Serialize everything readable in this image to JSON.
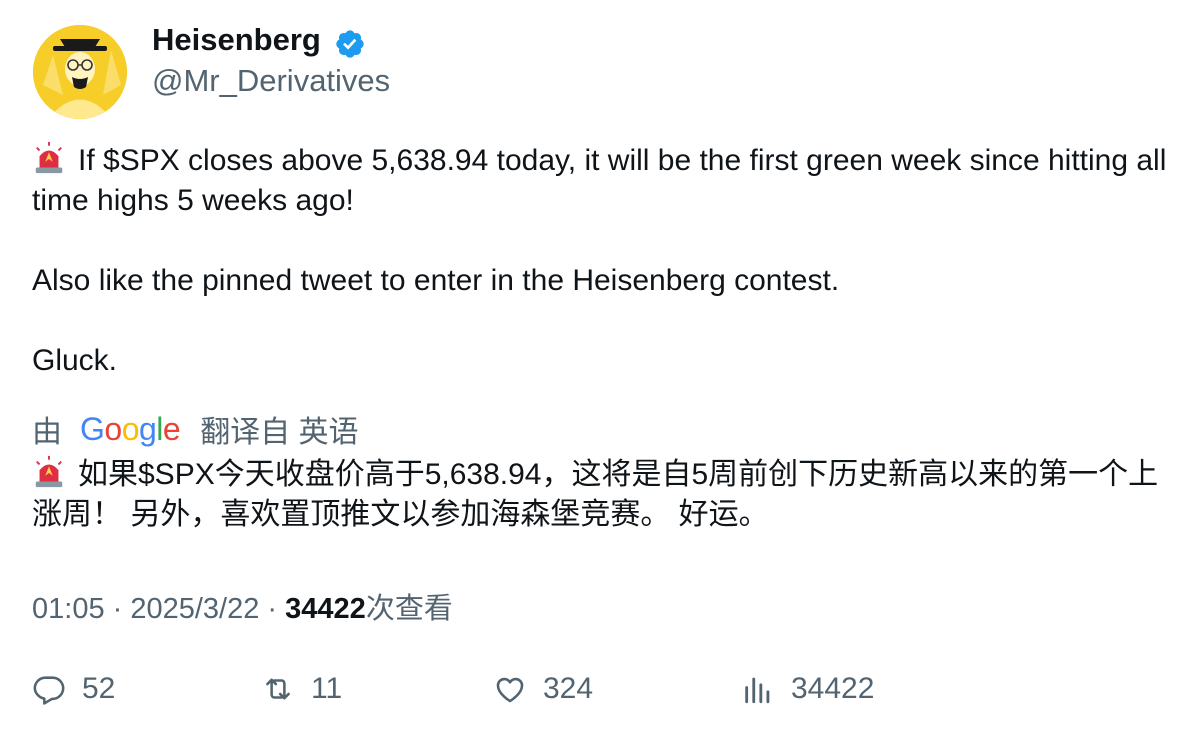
{
  "author": {
    "name": "Heisenberg",
    "handle": "@Mr_Derivatives",
    "verified_icon": "verified-badge-icon",
    "avatar_icon": "heisenberg-avatar"
  },
  "tweet": {
    "lines": [
      "If $SPX closes above 5,638.94 today, it will be the first green week since hitting all time highs 5 weeks ago!",
      "Also like the pinned tweet to enter in the Heisenberg contest.",
      "Gluck."
    ]
  },
  "translation": {
    "by": "由",
    "provider": "Google",
    "from": "翻译自 英语",
    "text": "如果$SPX今天收盘价高于5,638.94，这将是自5周前创下历史新高以来的第一个上涨周！ 另外，喜欢置顶推文以参加海森堡竞赛。 好运。"
  },
  "meta": {
    "time": "01:05",
    "sep1": " · ",
    "date": "2025/3/22",
    "sep2": " · ",
    "views": "34422",
    "views_suffix": "次查看"
  },
  "actions": {
    "replies": "52",
    "retweets": "11",
    "likes": "324",
    "views": "34422"
  },
  "colors": {
    "text": "#0f1419",
    "secondary": "#536471",
    "verified": "#1d9bf0",
    "avatar_bg": "#f7cd2a"
  }
}
